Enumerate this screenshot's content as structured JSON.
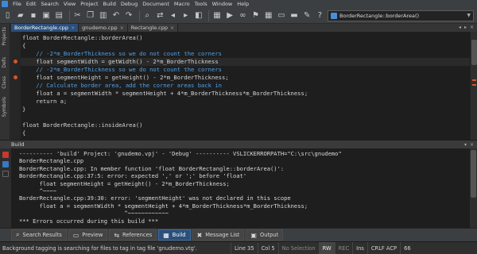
{
  "menu": {
    "items": [
      "File",
      "Edit",
      "Search",
      "View",
      "Project",
      "Build",
      "Debug",
      "Document",
      "Macro",
      "Tools",
      "Window",
      "Help"
    ]
  },
  "toolbar": {
    "icons": [
      "new-file-icon",
      "open-folder-icon",
      "save-icon",
      "save-all-icon",
      "print-icon",
      "cut-icon",
      "copy-icon",
      "paste-icon",
      "undo-icon",
      "redo-icon",
      "find-icon",
      "replace-icon",
      "back-icon",
      "forward-icon",
      "toggle-icon",
      "build-icon",
      "run-icon",
      "binoculars-icon",
      "bookmark-icon",
      "calculator-icon",
      "screen-icon",
      "terminal-icon",
      "wrench-icon",
      "help-icon"
    ],
    "context_combo_value": "BorderRectangle::borderArea()"
  },
  "side_tabs": [
    "Projects",
    "Defs",
    "Class",
    "Symbols"
  ],
  "file_tabs": [
    {
      "label": "BorderRectangle.cpp",
      "active": true
    },
    {
      "label": "gnudemo.cpp",
      "active": false
    },
    {
      "label": "Rectangle.cpp",
      "active": false
    }
  ],
  "editor": {
    "lines": [
      {
        "segments": [
          {
            "t": "float BorderRectangle::",
            "c": "fn"
          },
          {
            "t": "borderArea",
            "c": "fnh"
          },
          {
            "t": "()",
            "c": "fn"
          }
        ]
      },
      {
        "segments": [
          {
            "t": "{",
            "c": "fn"
          }
        ]
      },
      {
        "segments": [
          {
            "t": "    // -2*m_BorderThickness so we do not count the corners",
            "c": "cm"
          }
        ]
      },
      {
        "segments": [
          {
            "t": "    float segmentWidth = getWidth() - 2*m_BorderThickness",
            "c": "fn"
          }
        ],
        "current": true
      },
      {
        "segments": [
          {
            "t": "    // -2*m_BorderThickness so we do not count the corners",
            "c": "cm"
          }
        ]
      },
      {
        "segments": [
          {
            "t": "    float segmentHeight = getHeight() - 2*m_BorderThickness;",
            "c": "fn"
          }
        ]
      },
      {
        "segments": [
          {
            "t": "    // Calculate border area, add the corner areas back in",
            "c": "cm"
          }
        ]
      },
      {
        "segments": [
          {
            "t": "    float a = segmentWidth * segmentHeight + 4*m_BorderThickness*m_BorderThickness;",
            "c": "fn"
          }
        ]
      },
      {
        "segments": [
          {
            "t": "    return a;",
            "c": "fn"
          }
        ]
      },
      {
        "segments": [
          {
            "t": "}",
            "c": "fn"
          }
        ]
      },
      {
        "segments": [
          {
            "t": "",
            "c": "fn"
          }
        ]
      },
      {
        "segments": [
          {
            "t": "float BorderRectangle::",
            "c": "fn"
          },
          {
            "t": "insideArea",
            "c": "fnh"
          },
          {
            "t": "()",
            "c": "fn"
          }
        ]
      },
      {
        "segments": [
          {
            "t": "{",
            "c": "fn"
          }
        ]
      }
    ]
  },
  "build_panel": {
    "title": "Build",
    "lines": [
      "---------- 'build' Project: 'gnudemo.vpj' - 'Debug' ---------- VSLICKERRORPATH=\"C:\\src\\gnudemo\"",
      "BorderRectangle.cpp",
      "BorderRectangle.cpp: In member function 'float BorderRectangle::borderArea()':",
      "BorderRectangle.cpp:37:5: error: expected ',' or ';' before 'float'",
      "      float segmentHeight = getHeight() - 2*m_BorderThickness;",
      "      ^~~~~",
      "BorderRectangle.cpp:39:30: error: 'segmentHeight' was not declared in this scope",
      "      float a = segmentWidth * segmentHeight + 4*m_BorderThickness*m_BorderThickness;",
      "                               ^~~~~~~~~~~~~",
      "*** Errors occurred during this build ***"
    ]
  },
  "tool_tabs": [
    {
      "label": "Search Results",
      "icon": "binoculars-icon",
      "glyph": "⌕",
      "active": false
    },
    {
      "label": "Preview",
      "icon": "preview-icon",
      "glyph": "▭",
      "active": false
    },
    {
      "label": "References",
      "icon": "references-icon",
      "glyph": "⇆",
      "active": false
    },
    {
      "label": "Build",
      "icon": "build-icon",
      "glyph": "▦",
      "active": true
    },
    {
      "label": "Message List",
      "icon": "error-icon",
      "glyph": "✖",
      "active": false
    },
    {
      "label": "Output",
      "icon": "output-icon",
      "glyph": "▣",
      "active": false
    }
  ],
  "status": {
    "message": "Background tagging is searching for files to tag in tag file 'gnudemo.vtg'.",
    "line": "Line 35",
    "col": "Col 5",
    "selection": "No Selection",
    "rw": "RW",
    "rec": "REC",
    "ins": "Ins",
    "eol": "CRLF ACP",
    "num": "66"
  },
  "colors": {
    "accent": "#2b4f7a",
    "comment": "#4fa0e8",
    "error_marker": "#d9552b"
  }
}
